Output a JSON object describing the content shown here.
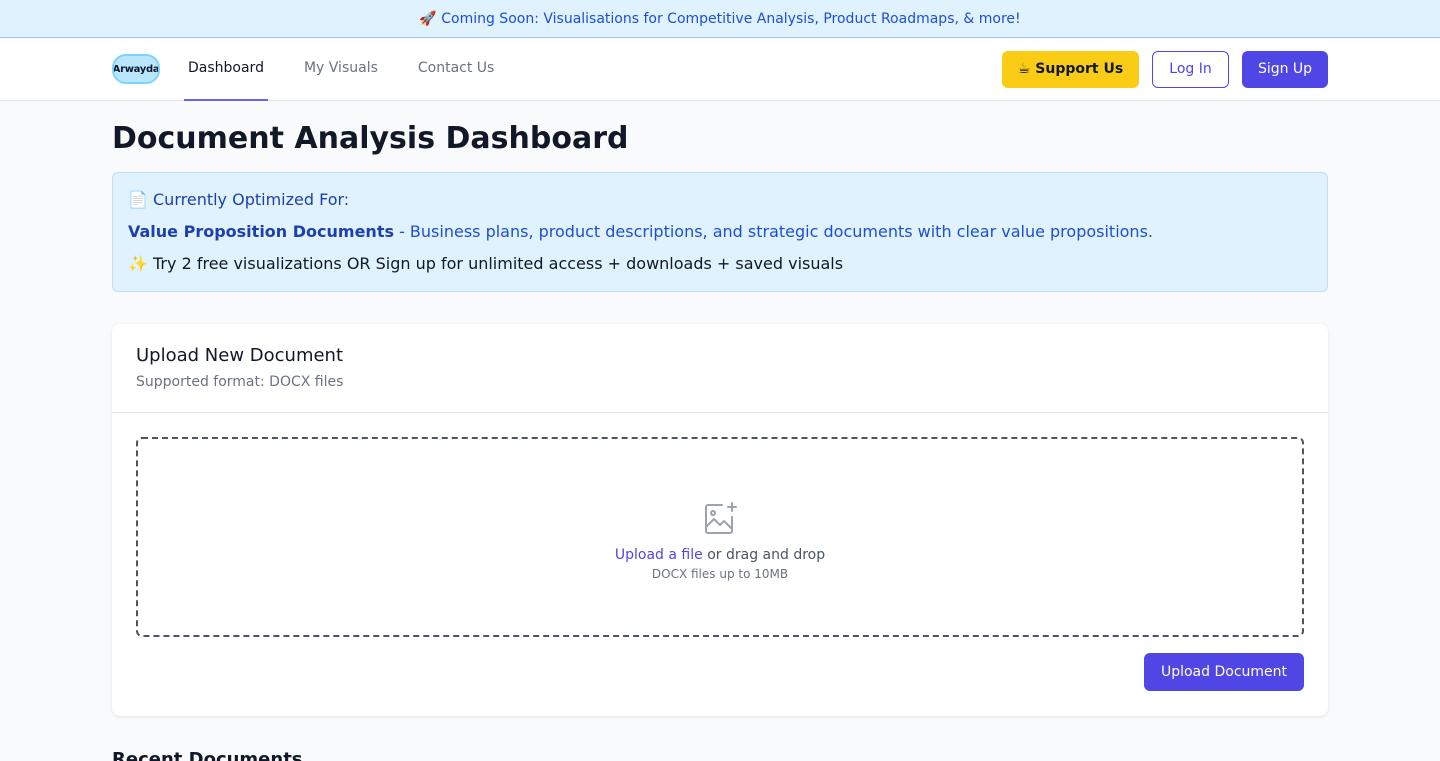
{
  "banner": {
    "text": "🚀 Coming Soon: Visualisations for Competitive Analysis, Product Roadmaps, & more!"
  },
  "nav": {
    "logo_text": "Arwayda",
    "links": [
      {
        "label": "Dashboard",
        "active": true
      },
      {
        "label": "My Visuals",
        "active": false
      },
      {
        "label": "Contact Us",
        "active": false
      }
    ],
    "support_label": "☕ Support Us",
    "login_label": "Log In",
    "signup_label": "Sign Up"
  },
  "page": {
    "title": "Document Analysis Dashboard"
  },
  "info": {
    "title": "📄 Currently Optimized For:",
    "highlight": "Value Proposition Documents",
    "description": " - Business plans, product descriptions, and strategic documents with clear value propositions.",
    "offer": "✨ Try 2 free visualizations OR Sign up for unlimited access + downloads + saved visuals"
  },
  "upload": {
    "title": "Upload New Document",
    "subtitle": "Supported format: DOCX files",
    "link_text": "Upload a file",
    "drag_text": " or drag and drop",
    "hint": "DOCX files up to 10MB",
    "button_label": "Upload Document",
    "icon": "image-upload-icon"
  },
  "recent": {
    "title": "Recent Documents"
  },
  "colors": {
    "accent": "#4f46e5",
    "support": "#facc15",
    "info_bg": "#e0f2fe"
  }
}
